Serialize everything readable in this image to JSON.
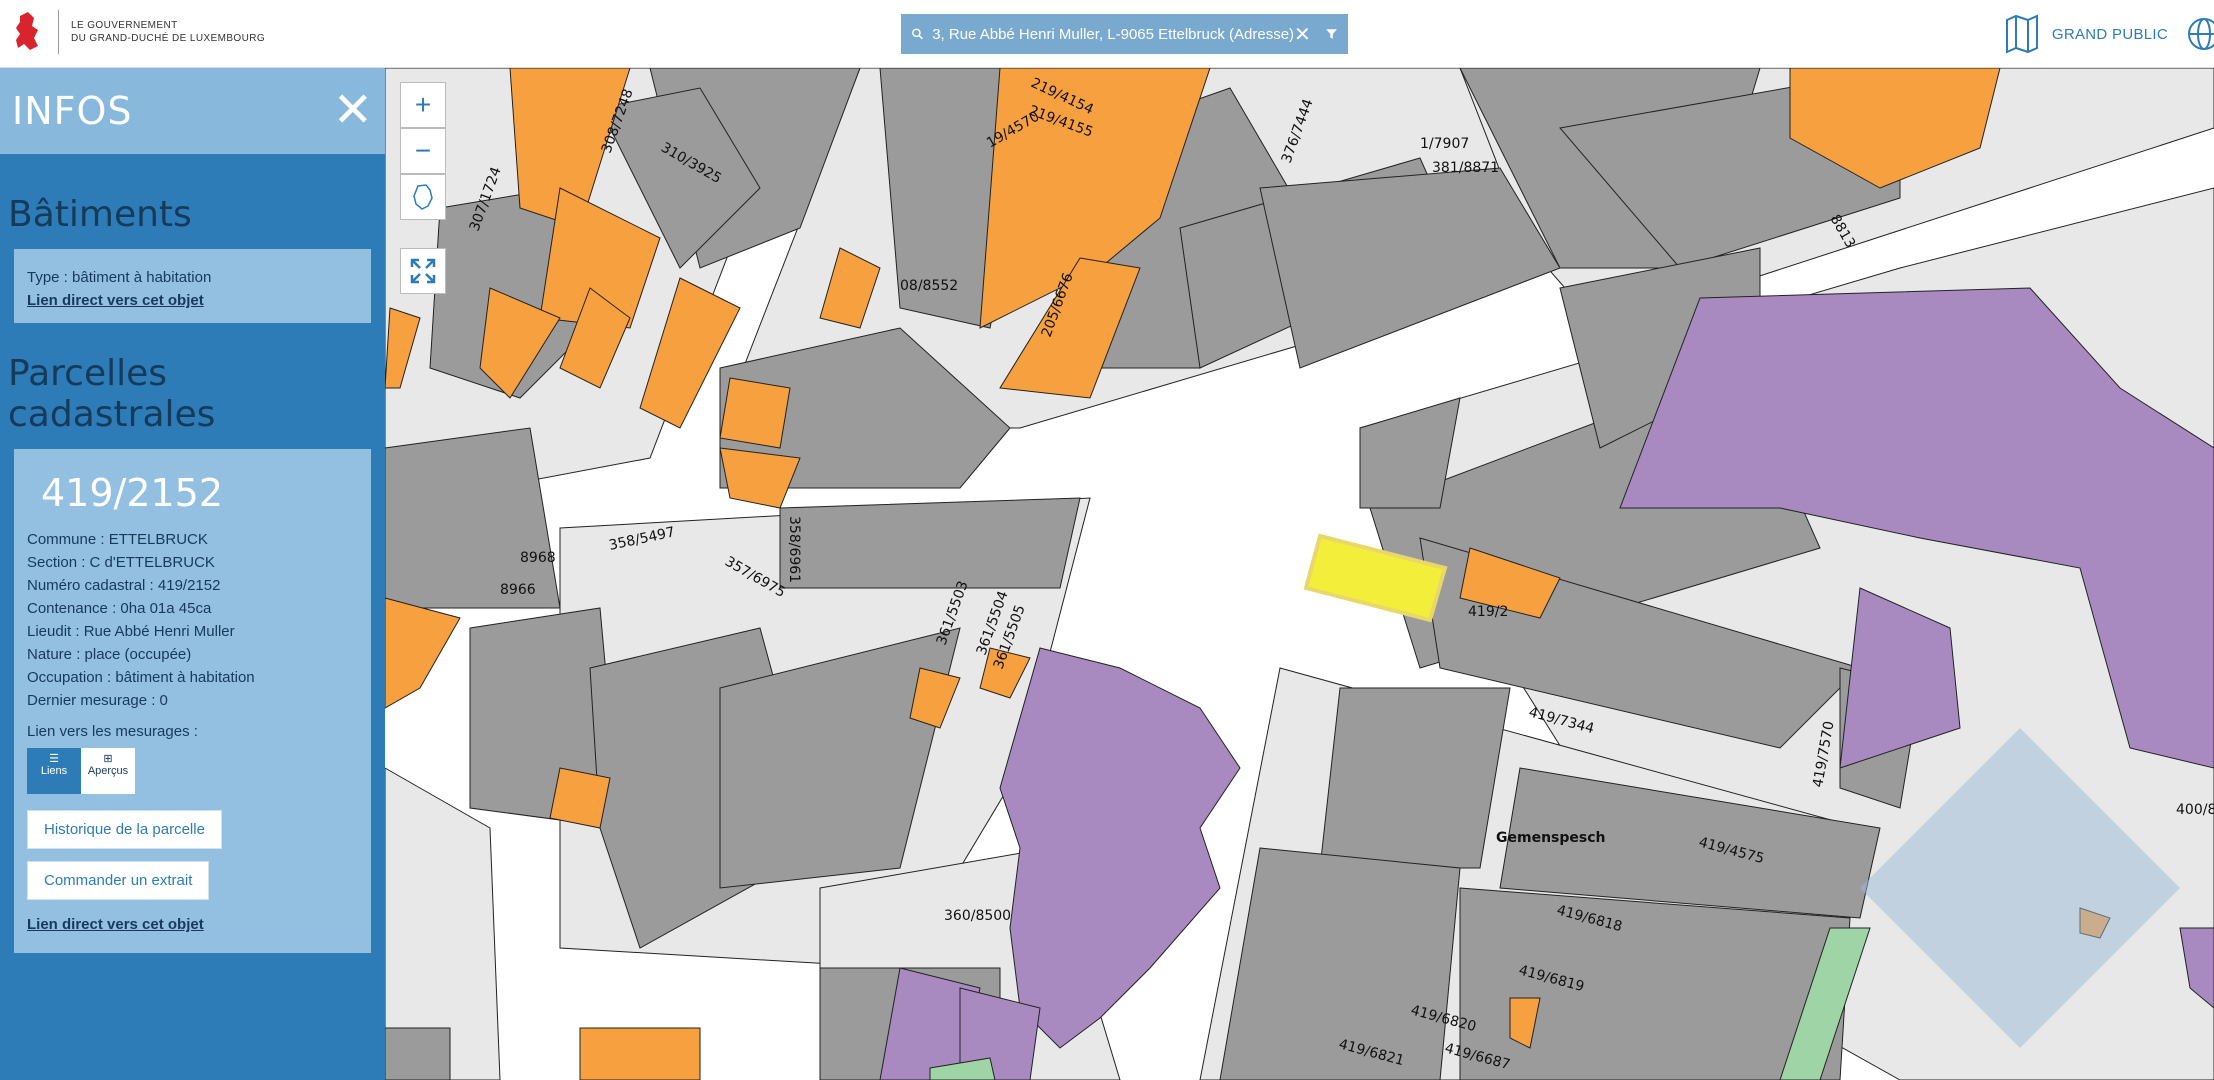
{
  "header": {
    "logo_line1": "LE GOUVERNEMENT",
    "logo_line2": "DU GRAND-DUCHÉ DE LUXEMBOURG",
    "search_value": "3, Rue Abbé Henri Muller, L-9065 Ettelbruck (Adresse)",
    "audience_label": "GRAND PUBLIC"
  },
  "panel": {
    "title": "INFOS",
    "batiments": {
      "heading": "Bâtiments",
      "type": "Type : bâtiment à habitation",
      "link": "Lien direct vers cet objet"
    },
    "parcelles": {
      "heading": "Parcelles cadastrales",
      "number": "419/2152",
      "fields": [
        "Commune : ETTELBRUCK",
        "Section : C d'ETTELBRUCK",
        "Numéro cadastral : 419/2152",
        "Contenance : 0ha 01a 45ca",
        "Lieudit : Rue Abbé Henri Muller",
        "Nature : place (occupée)",
        "Occupation : bâtiment à habitation",
        "Dernier mesurage : 0"
      ],
      "mesurages_label": "Lien vers les mesurages :",
      "toggle_liens": "Liens",
      "toggle_apercus": "Aperçus",
      "history_button": "Historique de la parcelle",
      "order_button": "Commander un extrait",
      "link": "Lien direct vers cet objet"
    }
  },
  "map": {
    "zoom_in": "+",
    "zoom_out": "−",
    "labels": [
      "308/7248",
      "310/3925",
      "307/1724",
      "219/4154",
      "219/4155",
      "19/4570",
      "376/7444",
      "1/7907",
      "381/8871",
      "8813",
      "205/6676",
      "08/8552",
      "358/5497",
      "357/6975",
      "358/6961",
      "361/5503",
      "361/5504",
      "361/5505",
      "8968",
      "8966",
      "419/2",
      "419/7344",
      "419/7570",
      "Gemenspesch",
      "419/4575",
      "419/6818",
      "419/6819",
      "419/6820",
      "419/6821",
      "419/6687",
      "360/8500",
      "400/8"
    ]
  },
  "colors": {
    "panel_blue": "#2d7cb8",
    "panel_light": "#93c0e0",
    "building_gray": "#9b9b9b",
    "building_orange": "#f7a040",
    "building_purple": "#a88ac1",
    "selected_yellow": "#f2ee3a",
    "parcel_light": "#e8e8e8"
  }
}
